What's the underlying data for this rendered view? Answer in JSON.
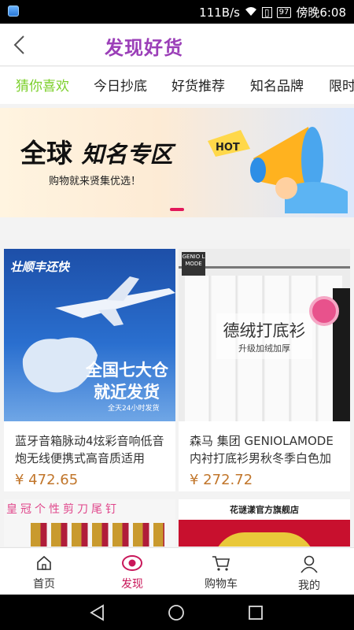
{
  "status_bar": {
    "net_speed": "111B/s",
    "battery": "97",
    "time": "傍晚6:08"
  },
  "header": {
    "title": "发现好货"
  },
  "tabs": [
    {
      "label": "猜你喜欢"
    },
    {
      "label": "今日抄底"
    },
    {
      "label": "好货推荐"
    },
    {
      "label": "知名品牌"
    },
    {
      "label": "限时"
    }
  ],
  "banner": {
    "headline_a": "全球",
    "headline_b": "知名专区",
    "subline": "购物就来贤集优选！",
    "badge": "HOT"
  },
  "products": [
    {
      "name": "蓝牙音箱脉动4炫彩音响低音炮无线便携式高音质适用",
      "price": "¥ 472.65",
      "img_logo": "壮顺丰还快",
      "img_text1": "全国七大仓",
      "img_text2": "就近发货",
      "img_small": "全天24小时发货"
    },
    {
      "name": "森马 集团 GENIOLAMODE内衬打底衫男秋冬季白色加",
      "price": "¥ 272.72",
      "img_tag": "GENIO L MODE",
      "img_text1": "德绒打底衫",
      "img_text2": "升级加绒加厚"
    },
    {
      "img_text1": "皇冠个性剪刀尾钉"
    },
    {
      "img_text1": "花谜漾官方旗舰店"
    }
  ],
  "bottom_nav": [
    {
      "label": "首页"
    },
    {
      "label": "发现"
    },
    {
      "label": "购物车"
    },
    {
      "label": "我的"
    }
  ],
  "colors": {
    "accent": "#c9175a",
    "tab_active": "#7bcf2a",
    "title": "#9b3fb8",
    "price": "#c1762b"
  }
}
